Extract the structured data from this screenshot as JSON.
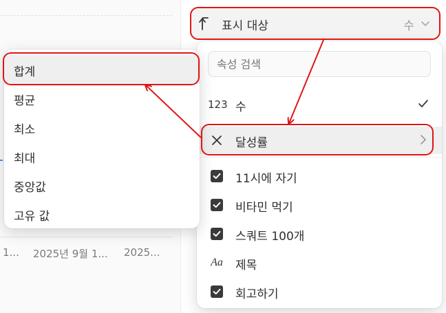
{
  "background": {
    "axis_labels": [
      "1...",
      "2025년 9월 1...",
      "2025..."
    ]
  },
  "header": {
    "icon": "sort-arrow-icon",
    "title": "표시 대상",
    "value": "수",
    "chevron_icon": "chevron-down-icon"
  },
  "panel": {
    "search_placeholder": "속성 검색",
    "count_row": {
      "icon_text": "123",
      "label": "수",
      "checked": true,
      "check_icon": "checkmark-icon"
    },
    "progress_row": {
      "icon": "x-icon",
      "label": "달성률",
      "arrow_icon": "chevron-right-icon"
    },
    "properties": [
      {
        "icon": "checkbox-icon",
        "label": "11시에 자기"
      },
      {
        "icon": "checkbox-icon",
        "label": "비타민 먹기"
      },
      {
        "icon": "checkbox-icon",
        "label": "스쿼트 100개"
      },
      {
        "icon": "text-aa-icon",
        "icon_text": "Aa",
        "label": "제목"
      },
      {
        "icon": "checkbox-icon",
        "label": "회고하기"
      }
    ]
  },
  "popup": {
    "items": [
      "합계",
      "평균",
      "최소",
      "최대",
      "중앙값",
      "고유 값"
    ],
    "selected": "합계"
  },
  "colors": {
    "annotation": "#e11414",
    "highlight": "#efefef",
    "accent_tick": "#4b8fe6"
  }
}
